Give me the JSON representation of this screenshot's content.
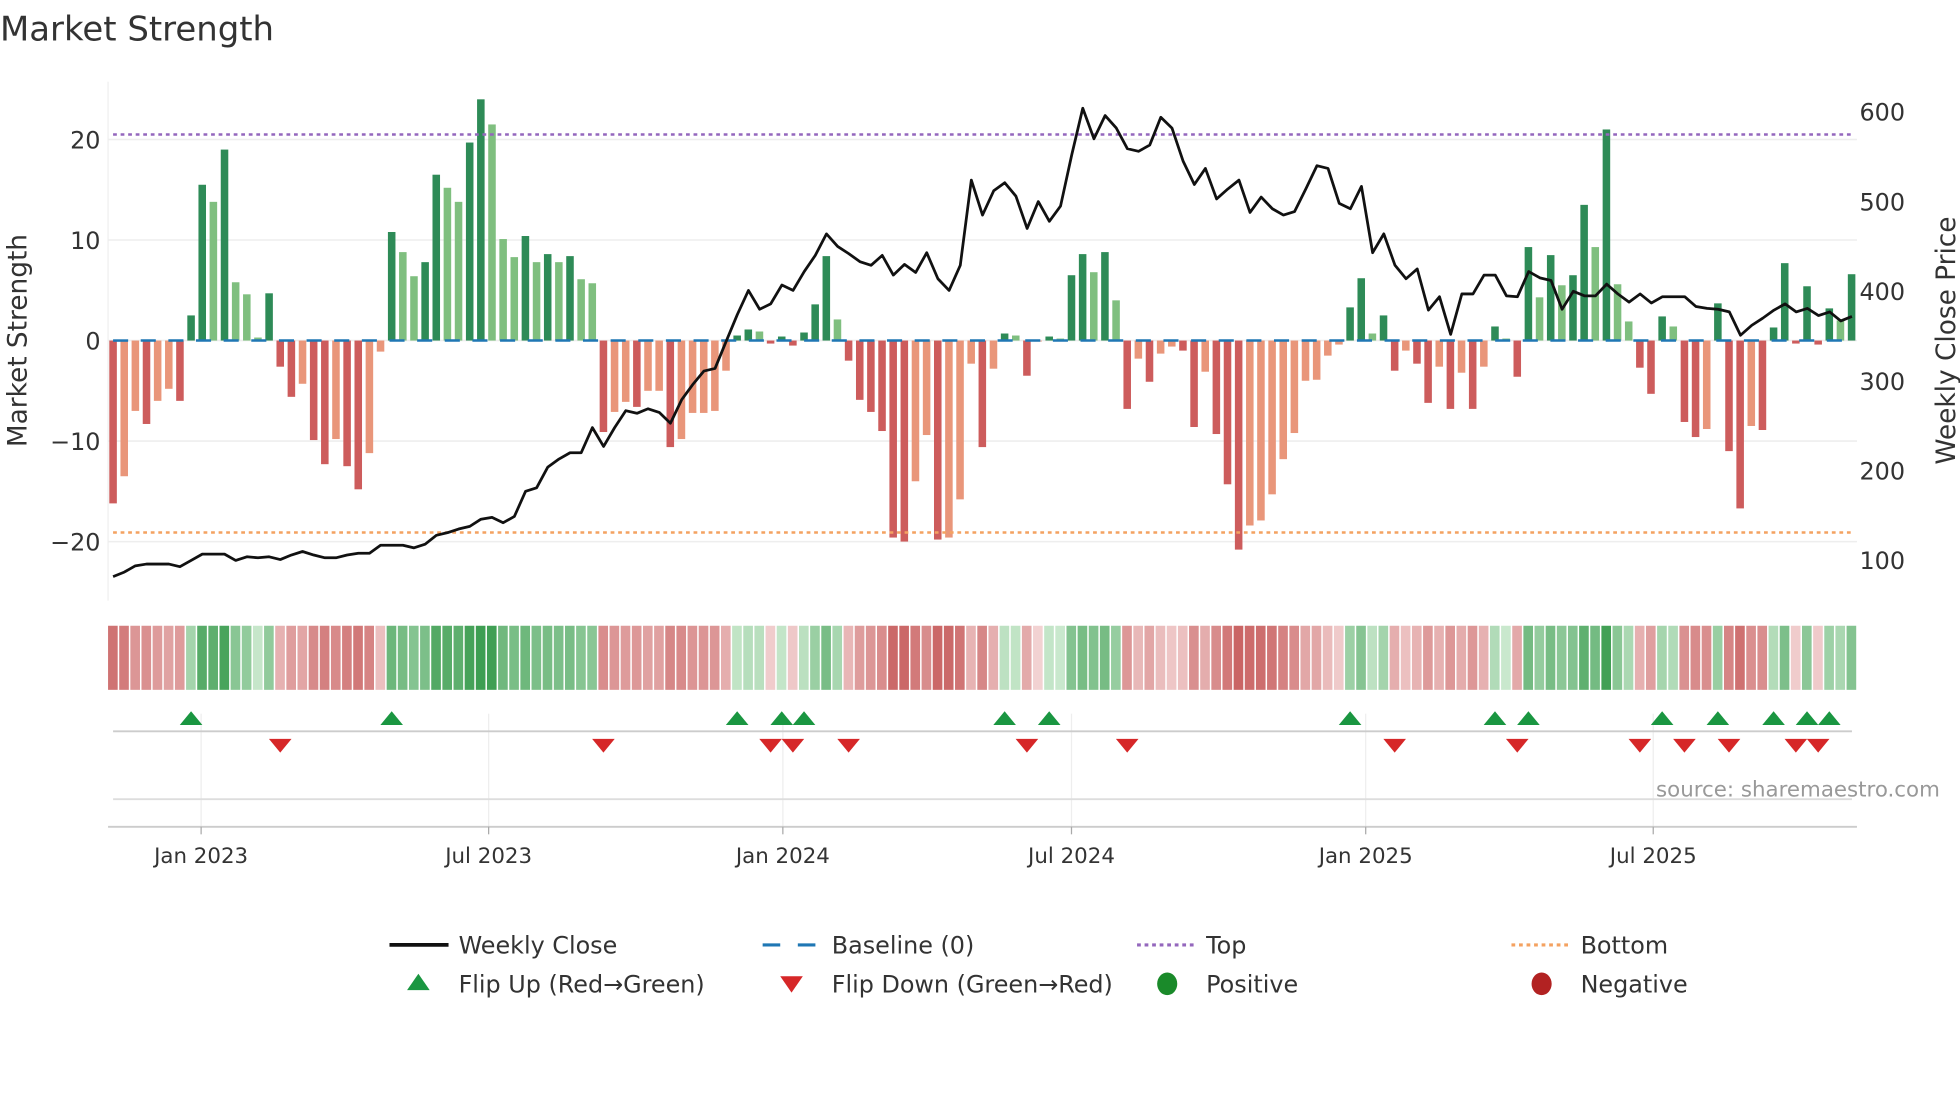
{
  "title": "Market Strength",
  "source": "source: sharemaestro.com",
  "chart_data": {
    "type": "bar",
    "title": "Market Strength",
    "x_unit": "week index",
    "ylabel": "Market Strength",
    "y2label": "Weekly Close Price",
    "ylim": [
      -25,
      26
    ],
    "y2lim": [
      50,
      630
    ],
    "yticks": [
      -20,
      -10,
      0,
      10,
      20
    ],
    "y2ticks": [
      100,
      200,
      300,
      400,
      500,
      600
    ],
    "xticks": [
      {
        "label": "Jan 2023",
        "week": 7.9
      },
      {
        "label": "Jul 2023",
        "week": 33.7
      },
      {
        "label": "Jan 2024",
        "week": 60.1
      },
      {
        "label": "Jul 2024",
        "week": 86.0
      },
      {
        "label": "Jan 2025",
        "week": 112.4
      },
      {
        "label": "Jul 2025",
        "week": 138.2
      }
    ],
    "top_level": 20.5,
    "bottom_level": -19.1,
    "baseline": 0,
    "strength": [
      -16.2,
      -13.5,
      -7,
      -8.3,
      -6,
      -4.8,
      -6,
      2.5,
      15.5,
      13.8,
      19,
      5.8,
      4.6,
      0.3,
      4.7,
      -2.6,
      -5.6,
      -4.3,
      -9.9,
      -12.3,
      -9.8,
      -12.5,
      -14.8,
      -11.2,
      -1.1,
      10.8,
      8.8,
      6.4,
      7.8,
      16.5,
      15.2,
      13.8,
      19.7,
      24,
      21.5,
      10.1,
      8.3,
      10.4,
      7.8,
      8.6,
      7.8,
      8.4,
      6.1,
      5.7,
      -9.1,
      -7.1,
      -6.1,
      -6.6,
      -5,
      -5,
      -10.6,
      -9.8,
      -7.2,
      -7.2,
      -7,
      -3,
      0.5,
      1.1,
      0.9,
      -0.3,
      0.4,
      -0.5,
      0.8,
      3.6,
      8.4,
      2.1,
      -2,
      -5.9,
      -7.1,
      -9,
      -19.6,
      -20,
      -14,
      -9.4,
      -19.8,
      -19.6,
      -15.8,
      -2.3,
      -10.6,
      -2.8,
      0.7,
      0.5,
      -3.5,
      -0.1,
      0.4,
      0.2,
      6.5,
      8.6,
      6.8,
      8.8,
      4,
      -6.8,
      -1.8,
      -4.1,
      -1.3,
      -0.6,
      -1,
      -8.6,
      -3.1,
      -9.3,
      -14.3,
      -20.8,
      -18.4,
      -17.9,
      -15.3,
      -11.8,
      -9.2,
      -4,
      -3.9,
      -1.5,
      -0.4,
      3.3,
      6.2,
      0.7,
      2.5,
      -3,
      -1,
      -2.3,
      -6.2,
      -2.6,
      -6.8,
      -3.2,
      -6.8,
      -2.6,
      1.4,
      0.2,
      -3.6,
      9.3,
      4.3,
      8.5,
      5.5,
      6.5,
      13.5,
      9.3,
      21,
      5.6,
      1.9,
      -2.7,
      -5.3,
      2.4,
      1.4,
      -8.1,
      -9.6,
      -8.8,
      3.7,
      -11,
      -16.7,
      -8.5,
      -8.9,
      1.3,
      7.7,
      -0.3,
      5.4,
      -0.4,
      3.2,
      2,
      6.6
    ],
    "weekly_close": [
      82,
      87,
      94,
      96,
      96,
      96,
      93,
      100,
      107,
      107,
      107,
      100,
      104,
      103,
      104,
      101,
      106,
      110,
      106,
      103,
      103,
      106,
      108,
      108,
      117,
      117,
      117,
      114,
      118,
      128,
      131,
      135,
      138,
      146,
      148,
      142,
      149,
      177,
      181,
      204,
      213,
      220,
      220,
      248,
      227,
      248,
      267,
      264,
      269,
      265,
      253,
      279,
      296,
      311,
      314,
      344,
      374,
      401,
      380,
      386,
      407,
      401,
      422,
      440,
      464,
      450,
      442,
      433,
      429,
      440,
      418,
      430,
      421,
      443,
      414,
      401,
      429,
      524,
      485,
      512,
      521,
      506,
      470,
      500,
      478,
      495,
      552,
      604,
      570,
      596,
      582,
      559,
      556,
      563,
      594,
      582,
      545,
      519,
      537,
      503,
      514,
      524,
      488,
      505,
      492,
      485,
      489,
      514,
      540,
      537,
      498,
      492,
      517,
      443,
      464,
      429,
      414,
      425,
      379,
      394,
      352,
      397,
      397,
      418,
      418,
      395,
      394,
      422,
      415,
      412,
      380,
      400,
      395,
      395,
      408,
      397,
      388,
      397,
      387,
      394,
      394,
      394,
      383,
      381,
      380,
      377,
      351,
      362,
      370,
      379,
      386,
      377,
      381,
      373,
      377,
      367,
      372
    ],
    "flip_up_weeks": [
      7,
      25,
      56,
      60,
      62,
      80,
      84,
      111,
      124,
      127,
      139,
      144,
      149,
      152,
      154
    ],
    "flip_down_weeks": [
      15,
      44,
      59,
      61,
      66,
      82,
      91,
      115,
      126,
      137,
      141,
      145,
      151,
      153
    ],
    "legend": [
      {
        "label": "Weekly Close",
        "kind": "line",
        "color": "#111111"
      },
      {
        "label": "Baseline (0)",
        "kind": "dash",
        "color": "#1f77b4"
      },
      {
        "label": "Top",
        "kind": "dot",
        "color": "#9467bd"
      },
      {
        "label": "Bottom",
        "kind": "dot",
        "color": "#f4a261"
      },
      {
        "label": "Flip Up (Red→Green)",
        "kind": "tri-up",
        "color": "#1a9641"
      },
      {
        "label": "Flip Down (Green→Red)",
        "kind": "tri-down",
        "color": "#d62728"
      },
      {
        "label": "Positive",
        "kind": "circle",
        "color": "#1a8a2a"
      },
      {
        "label": "Negative",
        "kind": "circle",
        "color": "#b22222"
      }
    ],
    "legend_position": "bottom",
    "colors": {
      "pos_rising": "#2e8b57",
      "pos_falling": "#7fbf7f",
      "neg_falling": "#cd5c5c",
      "neg_rising": "#e9967a"
    }
  }
}
